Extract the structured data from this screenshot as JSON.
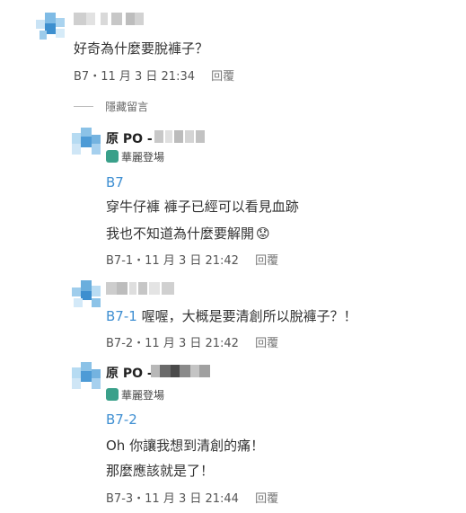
{
  "comments": [
    {
      "body_lines": [
        "好奇為什麼要脫褲子？"
      ],
      "meta": "B7・11 月 3 日 21:34",
      "reply_label": "回覆"
    }
  ],
  "hidden_toggle": "隱藏留言",
  "replies": [
    {
      "author_prefix": "原 PO -",
      "badge": "華麗登場",
      "ref": "B7",
      "lines": [
        "穿牛仔褲 褲子已經可以看見血跡",
        "我也不知道為什麼要解開"
      ],
      "emoji": "😟",
      "meta": "B7-1・11 月 3 日 21:42",
      "reply_label": "回覆"
    },
    {
      "ref": "B7-1",
      "inline_text": " 喔喔，大概是要清創所以脫褲子？！",
      "meta": "B7-2・11 月 3 日 21:42",
      "reply_label": "回覆"
    },
    {
      "author_prefix": "原 PO -",
      "badge": "華麗登場",
      "ref": "B7-2",
      "lines": [
        "Oh 你讓我想到清創的痛！",
        "那麼應該就是了！"
      ],
      "meta": "B7-3・11 月 3 日 21:44",
      "reply_label": "回覆"
    }
  ],
  "colors": {
    "link_blue": "#3f8fd2",
    "avatar_light": "#a9d3ef",
    "avatar_mid": "#6fb0de",
    "avatar_dark": "#3d8fcf",
    "badge_green": "#3aa08a"
  }
}
